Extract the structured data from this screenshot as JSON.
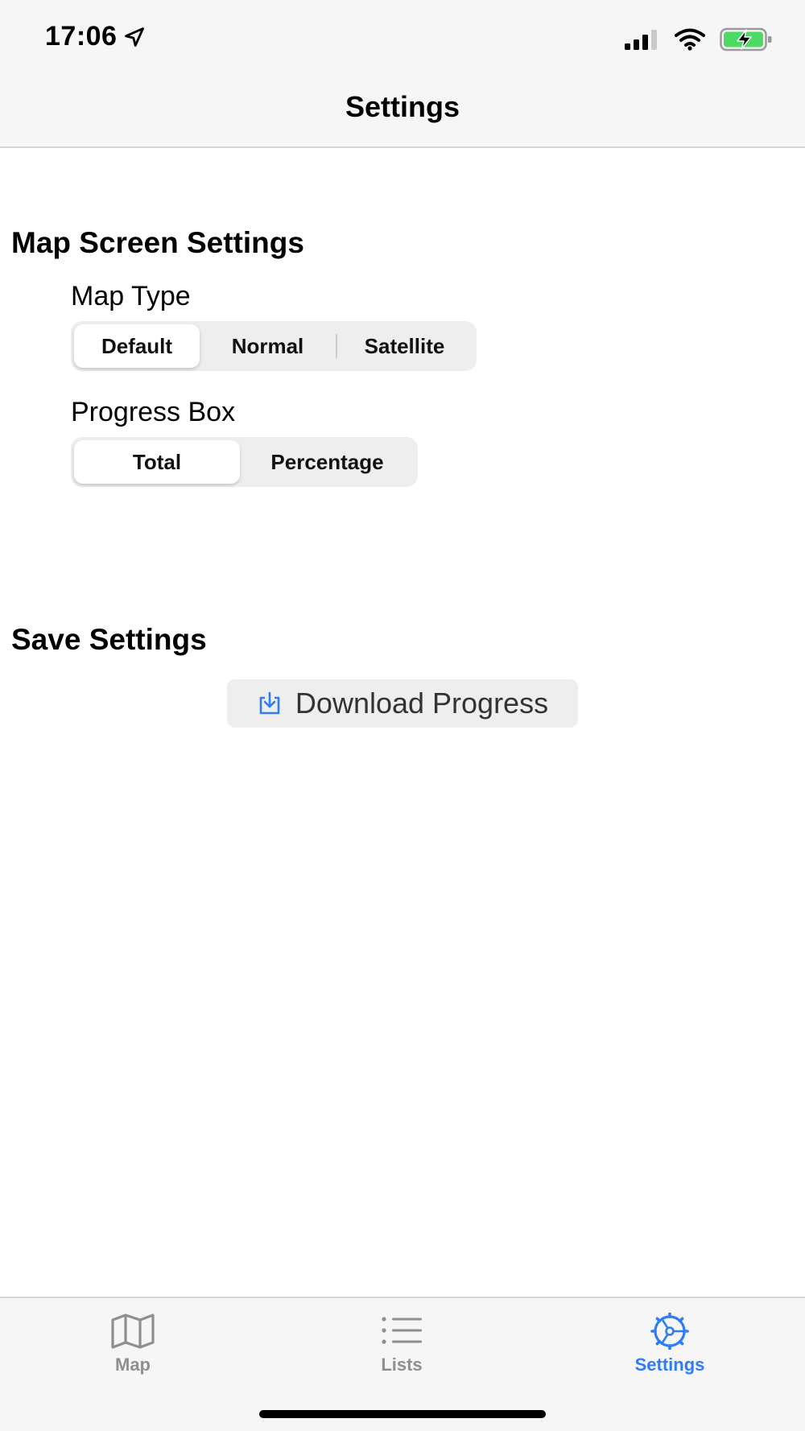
{
  "status_bar": {
    "time": "17:06",
    "location_icon": "location-arrow-icon",
    "signal_icon": "cellular-signal-icon",
    "wifi_icon": "wifi-icon",
    "battery_icon": "battery-charging-icon"
  },
  "nav": {
    "title": "Settings"
  },
  "map_screen": {
    "section_title": "Map Screen Settings",
    "map_type": {
      "label": "Map Type",
      "options": [
        "Default",
        "Normal",
        "Satellite"
      ],
      "selected": "Default"
    },
    "progress_box": {
      "label": "Progress Box",
      "options": [
        "Total",
        "Percentage"
      ],
      "selected": "Total"
    }
  },
  "save_settings": {
    "section_title": "Save Settings",
    "download_button": "Download Progress",
    "download_icon": "download-tray-icon"
  },
  "tabbar": {
    "tabs": [
      {
        "label": "Map",
        "icon": "map-icon",
        "active": false
      },
      {
        "label": "Lists",
        "icon": "list-icon",
        "active": false
      },
      {
        "label": "Settings",
        "icon": "settings-gear-icon",
        "active": true
      }
    ]
  },
  "colors": {
    "accent": "#2e7cf6",
    "inactive_tab": "#8e8e93",
    "bar_background": "#f6f6f6",
    "segment_background": "#eeeeef"
  }
}
